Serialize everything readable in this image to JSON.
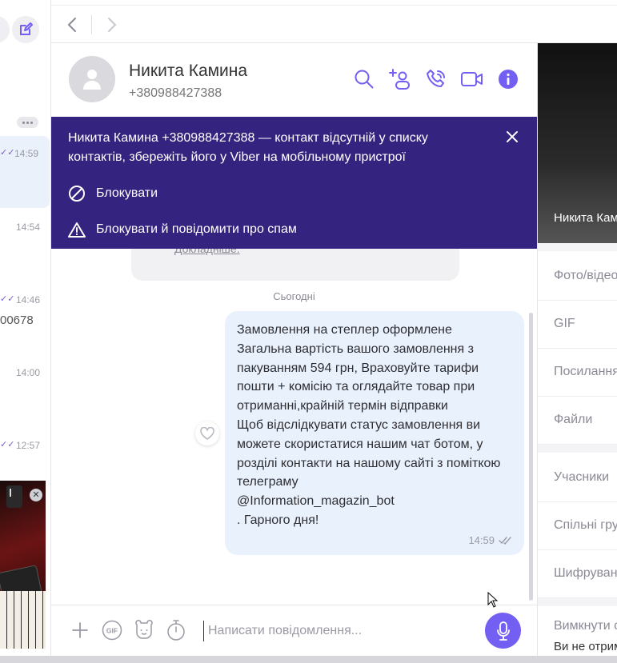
{
  "sidebar": {
    "more_label": "•••",
    "items": [
      {
        "time": "14:59",
        "checked": true,
        "snippet": ""
      },
      {
        "time": "14:54",
        "checked": false,
        "snippet": ""
      },
      {
        "time": "14:46",
        "checked": true,
        "snippet": "00678"
      },
      {
        "time": "14:00",
        "checked": false,
        "snippet": ""
      },
      {
        "time": "12:57",
        "checked": true,
        "snippet": ""
      }
    ],
    "thumb_close": "✕"
  },
  "chat": {
    "contact_name": "Никита Камина",
    "contact_phone": "+380988427388"
  },
  "banner": {
    "text": "Никита Камина +380988427388 — контакт відсутній у списку контактів, збережіть його у Viber на мобільному пристрої",
    "block_label": "Блокувати",
    "block_report_label": "Блокувати й повідомити про спам"
  },
  "messages": {
    "prev_link": "Докладніше.",
    "date_label": "Сьогодні",
    "bubble_text": "Замовлення на степлер оформлене\nЗагальна вартість вашого замовлення з пакуванням 594 грн, Враховуйте тарифи пошти + комісію  та оглядайте товар при отриманні,крайній термін відправки\nЩоб відслідкувати статус замовлення ви можете скористатися нашим чат ботом, у розділі контакти на нашому сайті з поміткою телеграму\n@Information_magazin_bot\n. Гарного дня!",
    "bubble_time": "14:59"
  },
  "composer": {
    "placeholder": "Написати повідомлення...",
    "gif_label": "GIF"
  },
  "info_panel": {
    "cover_name": "Никита Камина",
    "rows": [
      "Фото/відео",
      "GIF",
      "Посилання",
      "Файли",
      "Учасники",
      "Спільні групи",
      "Шифрування"
    ],
    "mute_label": "Вимкнути сповіщення",
    "mute_sub": "Ви не отримуєте"
  },
  "colors": {
    "accent": "#7360f2",
    "banner": "#35247f",
    "bubble": "#e9f1fd"
  }
}
